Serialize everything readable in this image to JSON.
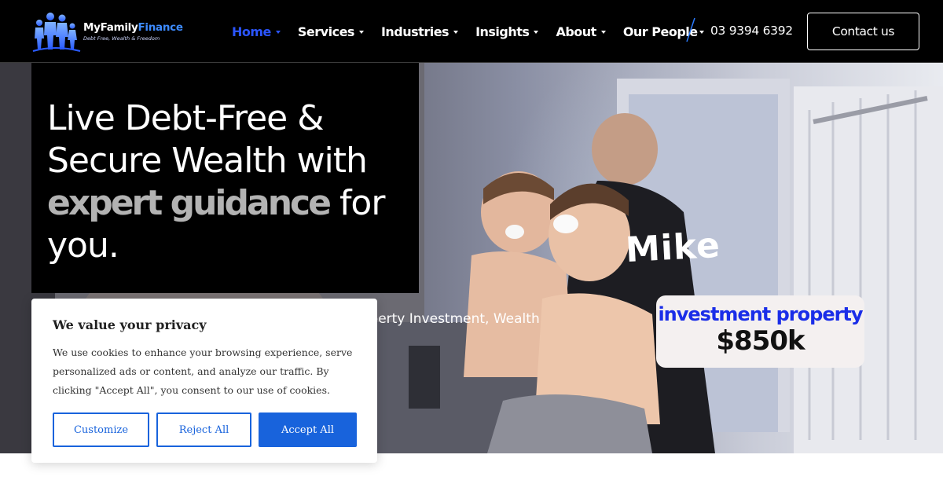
{
  "header": {
    "logo": {
      "name_part1": "MyFamily",
      "name_part2": "Finance",
      "tagline": "Debt Free, Wealth & Freedom"
    },
    "nav": [
      {
        "label": "Home",
        "active": true
      },
      {
        "label": "Services",
        "active": false
      },
      {
        "label": "Industries",
        "active": false
      },
      {
        "label": "Insights",
        "active": false
      },
      {
        "label": "About",
        "active": false
      },
      {
        "label": "Our People",
        "active": false
      }
    ],
    "phone": "03 9394 6392",
    "contact_label": "Contact us"
  },
  "hero": {
    "headline_line1": "Live Debt-Free &",
    "headline_line2": "Secure Wealth with",
    "headline_animated": "expert guidance",
    "headline_line3_rest": " for",
    "headline_line4": "you.",
    "subtext": "operty Investment, Wealth",
    "sticker_name": "Mike",
    "sticker_line1": "investment property",
    "sticker_line2": "$850k"
  },
  "cookie": {
    "title": "We value your privacy",
    "body": "We use cookies to enhance your browsing experience, serve personalized ads or content, and analyze our traffic. By clicking \"Accept All\", you consent to our use of cookies.",
    "customize_label": "Customize",
    "reject_label": "Reject All",
    "accept_label": "Accept All"
  },
  "colors": {
    "accent": "#2b55ff",
    "cookie_button": "#1863dc",
    "header_bg": "#000000"
  }
}
